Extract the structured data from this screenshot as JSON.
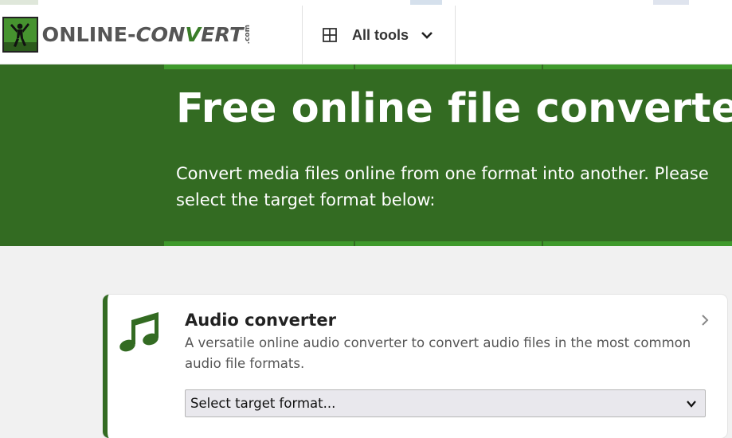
{
  "header": {
    "logo": {
      "brand_left": "ONLINE-",
      "brand_conv": "CON",
      "brand_v": "V",
      "brand_ert": "ERT",
      "dotcom": ".com"
    },
    "nav": {
      "all_tools_label": "All tools"
    }
  },
  "hero": {
    "title": "Free online file converter",
    "subtitle": "Convert media files online from one format into another. Please select the target format below:"
  },
  "card": {
    "icon": "music-note-icon",
    "title": "Audio converter",
    "description": "A versatile online audio converter to convert audio files in the most common audio file formats.",
    "select_value": "Select target format..."
  },
  "colors": {
    "brand_green": "#336b22",
    "stripe_green": "#3f9a2c",
    "text_dark": "#333333"
  }
}
